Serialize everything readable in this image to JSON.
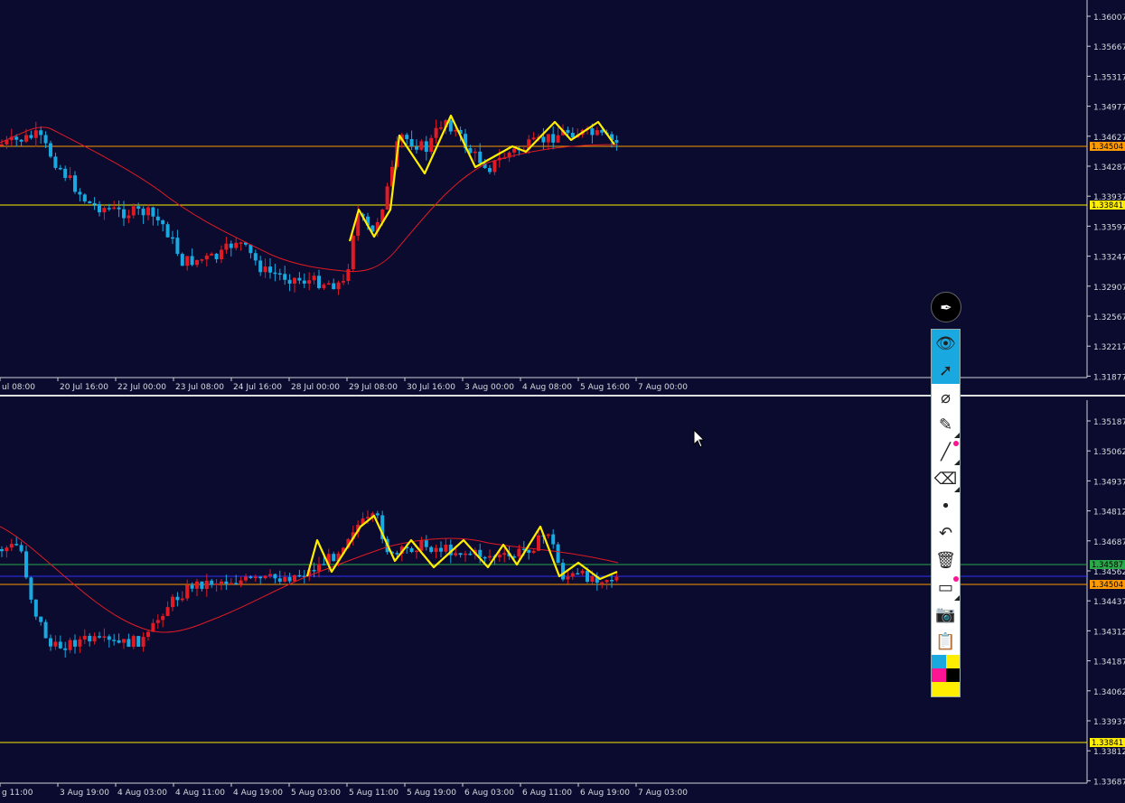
{
  "colors": {
    "background": "#0a0b2e",
    "bull_candle": "#e01b24",
    "bear_candle": "#19a9e0",
    "moving_average": "#e01b24",
    "zigzag": "#ffee00",
    "orange_line": "#ff9a00",
    "yellow_line": "#ffee00",
    "green_line": "#2aa84a",
    "blue_line": "#3030ff"
  },
  "top_chart": {
    "price_ticks": [
      "1.36007",
      "1.35667",
      "1.35317",
      "1.34977",
      "1.34627",
      "1.34287",
      "1.33937",
      "1.33597",
      "1.33247",
      "1.32907",
      "1.32567",
      "1.32217",
      "1.31877"
    ],
    "time_ticks": [
      "ul 08:00",
      "20 Jul 16:00",
      "22 Jul 00:00",
      "23 Jul 08:00",
      "24 Jul 16:00",
      "28 Jul 00:00",
      "29 Jul 08:00",
      "30 Jul 16:00",
      "3 Aug 00:00",
      "4 Aug 08:00",
      "5 Aug 16:00",
      "7 Aug 00:00"
    ],
    "price_marker_orange": "1.34504",
    "price_marker_yellow": "1.33841"
  },
  "bottom_chart": {
    "price_ticks": [
      "1.35187",
      "1.35062",
      "1.34937",
      "1.34812",
      "1.34687",
      "1.34562",
      "1.34437",
      "1.34312",
      "1.34187",
      "1.34062",
      "1.33937",
      "1.33812",
      "1.33687"
    ],
    "time_ticks": [
      "g 11:00",
      "3 Aug 19:00",
      "4 Aug 03:00",
      "4 Aug 11:00",
      "4 Aug 19:00",
      "5 Aug 03:00",
      "5 Aug 11:00",
      "5 Aug 19:00",
      "6 Aug 03:00",
      "6 Aug 11:00",
      "6 Aug 19:00",
      "7 Aug 03:00"
    ],
    "price_marker_green": "1.34587",
    "price_marker_orange": "1.34504",
    "price_marker_yellow": "1.33841"
  },
  "toolbar": {
    "pen_icon": "fountain-pen-icon",
    "tools": [
      {
        "name": "eye-icon",
        "glyph": "👁",
        "active": true
      },
      {
        "name": "arrow-cursor-icon",
        "glyph": "➚",
        "active": true
      },
      {
        "name": "compass-icon",
        "glyph": "⌀",
        "active": false
      },
      {
        "name": "highlighter-icon",
        "glyph": "✎",
        "active": false
      },
      {
        "name": "line-icon",
        "glyph": "╱",
        "active": false,
        "dot": true
      },
      {
        "name": "eraser-icon",
        "glyph": "⌫",
        "active": false
      },
      {
        "name": "point-icon",
        "glyph": "•",
        "active": false
      },
      {
        "name": "undo-icon",
        "glyph": "↶",
        "active": false
      },
      {
        "name": "trash-icon",
        "glyph": "🗑",
        "active": false
      },
      {
        "name": "monitor-icon",
        "glyph": "▭",
        "active": false,
        "dot": true
      },
      {
        "name": "camera-icon",
        "glyph": "📷",
        "active": false
      },
      {
        "name": "clipboard-icon",
        "glyph": "📋",
        "active": false
      }
    ],
    "swatch_colors": [
      "#19a9e0",
      "#ffee00",
      "#ff1493",
      "#000000",
      "#ffee00",
      "#ffee00"
    ]
  }
}
